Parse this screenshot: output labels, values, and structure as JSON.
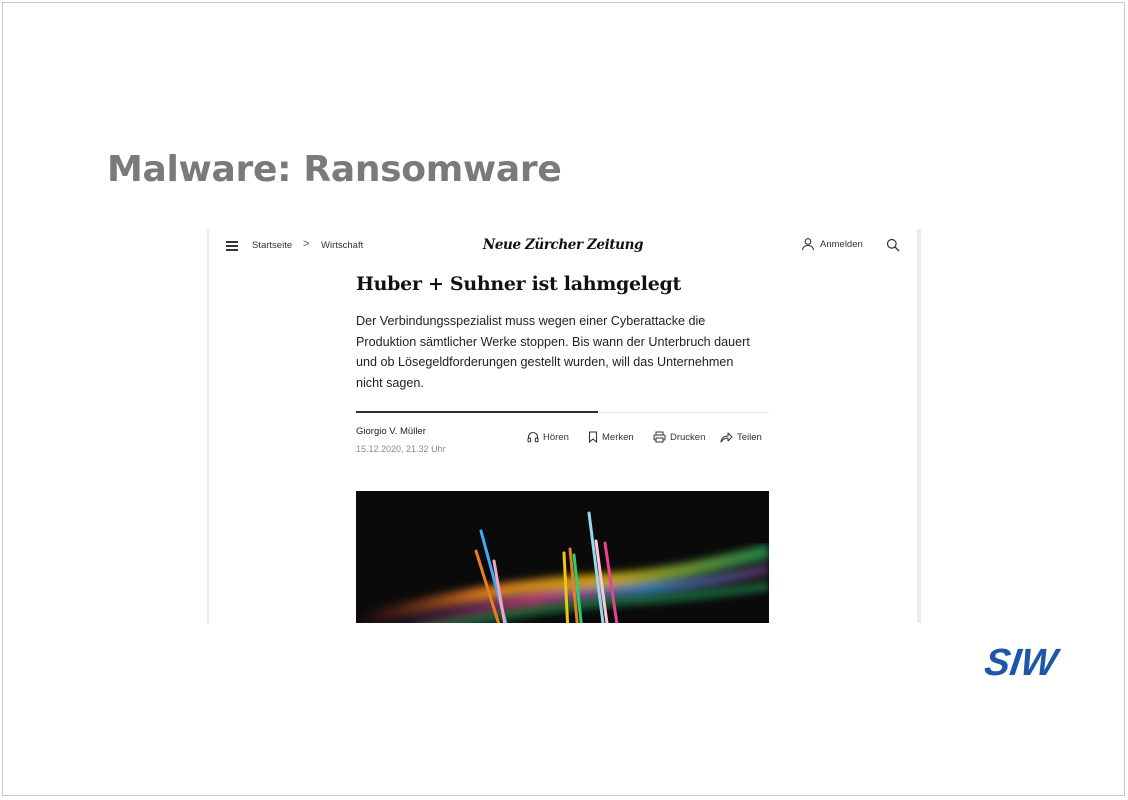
{
  "slide": {
    "title": "Malware: Ransomware"
  },
  "article_screenshot": {
    "nav": {
      "menu_icon": "hamburger-icon",
      "breadcrumb": [
        "Startseite",
        "Wirtschaft"
      ],
      "breadcrumb_separator": ">",
      "masthead": "Neue Zürcher Zeitung",
      "login_label": "Anmelden",
      "login_icon": "user-icon",
      "search_icon": "search-icon"
    },
    "headline": "Huber + Suhner ist lahmgelegt",
    "lead": "Der Verbindungsspezialist muss wegen einer Cyberattacke die Produktion sämtlicher Werke stoppen. Bis wann der Unterbruch dauert und ob Lösegeldforderungen gestellt wurden, will das Unternehmen nicht sagen.",
    "author": "Giorgio V. Müller",
    "date": "15.12.2020, 21.32 Uhr",
    "tools": [
      {
        "label": "Hören",
        "icon": "headphones-icon"
      },
      {
        "label": "Merken",
        "icon": "bookmark-icon"
      },
      {
        "label": "Drucken",
        "icon": "printer-icon"
      },
      {
        "label": "Teilen",
        "icon": "share-icon"
      }
    ]
  },
  "logo": {
    "text": "SIW",
    "color": "#1f57a8"
  }
}
